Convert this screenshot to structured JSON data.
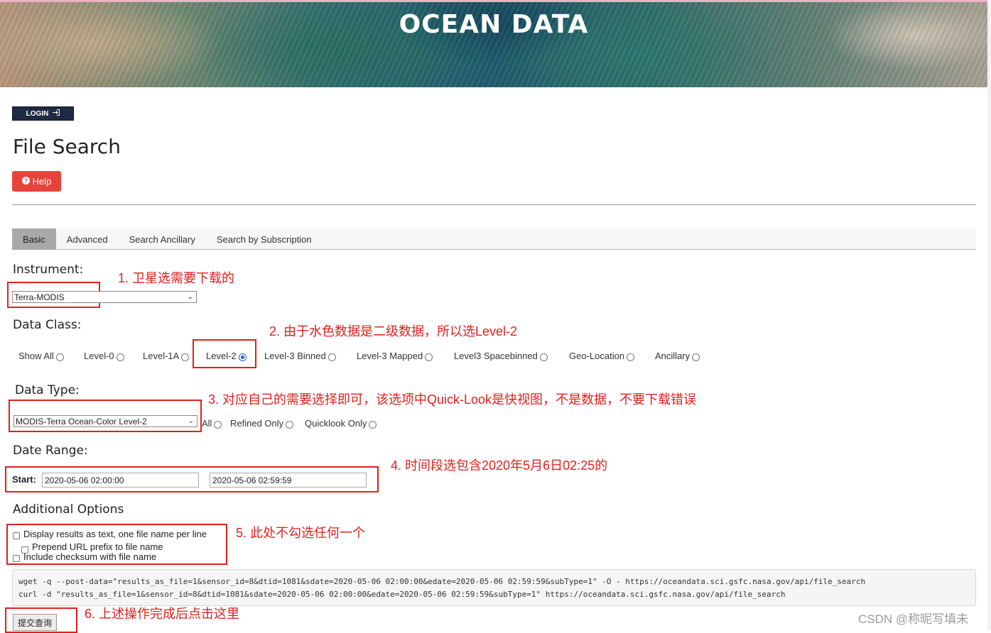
{
  "banner": {
    "title": "OCEAN DATA"
  },
  "header": {
    "login_label": "LOGIN",
    "login_icon": "sign-in-icon",
    "page_title": "File Search",
    "help_label": "Help",
    "help_icon": "question-circle-icon"
  },
  "tabs": [
    "Basic",
    "Advanced",
    "Search Ancillary",
    "Search by Subscription"
  ],
  "active_tab": "Basic",
  "instrument": {
    "label": "Instrument:",
    "selected": "Terra-MODIS"
  },
  "data_class": {
    "label": "Data Class:",
    "options": [
      "Show All",
      "Level-0",
      "Level-1A",
      "Level-2",
      "Level-3 Binned",
      "Level-3 Mapped",
      "Level3 Spacebinned",
      "Geo-Location",
      "Ancillary"
    ],
    "selected": "Level-2"
  },
  "data_type": {
    "label": "Data Type:",
    "selected": "MODIS-Terra Ocean-Color Level-2",
    "filters": [
      "All",
      "Refined Only",
      "Quicklook Only"
    ]
  },
  "date_range": {
    "label": "Date Range:",
    "start_label": "Start:",
    "start": "2020-05-06 02:00:00",
    "end": "2020-05-06 02:59:59"
  },
  "additional_options": {
    "label": "Additional Options",
    "items": [
      "Display results as text, one file name per line",
      "Prepend URL prefix to file name",
      "Include checksum with file name"
    ]
  },
  "command": {
    "wget": "wget -q --post-data=\"results_as_file=1&sensor_id=8&dtid=1081&sdate=2020-05-06 02:00:00&edate=2020-05-06 02:59:59&subType=1\" -O - https://oceandata.sci.gsfc.nasa.gov/api/file_search",
    "curl": "curl -d \"results_as_file=1&sensor_id=8&dtid=1081&sdate=2020-05-06 02:00:00&edate=2020-05-06 02:59:59&subType=1\" https://oceandata.sci.gsfc.nasa.gov/api/file_search"
  },
  "submit_label": "提交查询",
  "annotations": {
    "a1": "1. 卫星选需要下载的",
    "a2": "2. 由于水色数据是二级数据，所以选Level-2",
    "a3": "3. 对应自己的需要选择即可，该选项中Quick-Look是快视图，不是数据，不要下载错误",
    "a4": "4. 时间段选包含2020年5月6日02:25的",
    "a5": "5. 此处不勾选任何一个",
    "a6": "6. 上述操作完成后点击这里"
  },
  "watermark": "CSDN @称昵写填未",
  "colors": {
    "annotation_red": "#e0201e",
    "help_red": "#e8433a",
    "login_navy": "#1f2a44",
    "radio_blue": "#1a66d6"
  }
}
